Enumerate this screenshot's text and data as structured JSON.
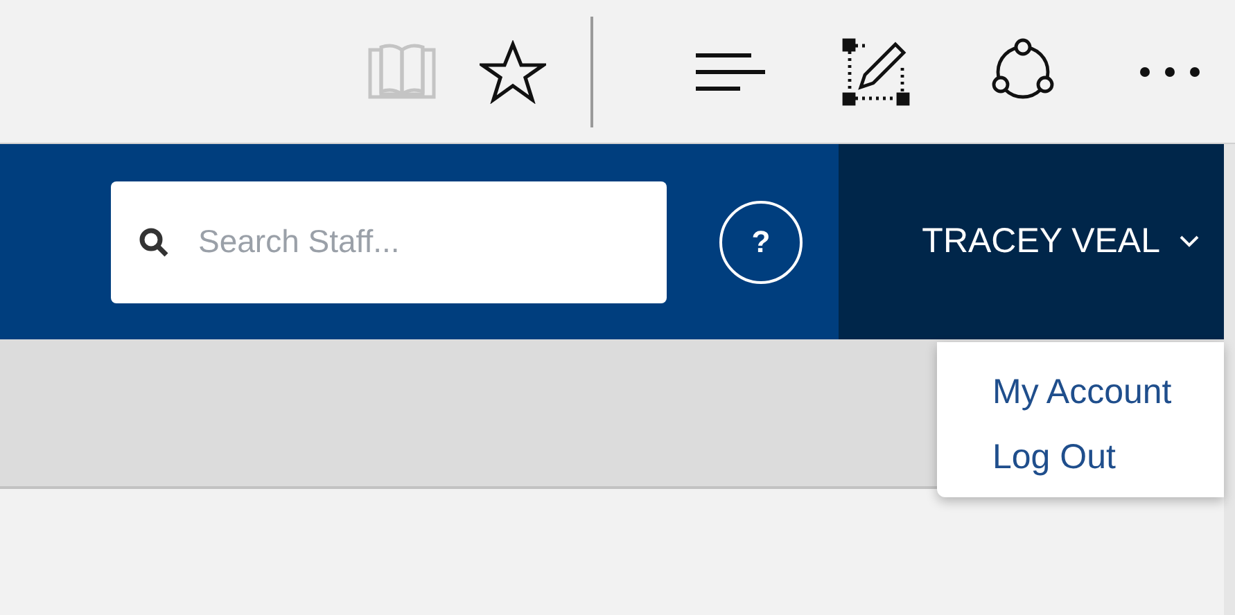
{
  "browser_toolbar": {
    "items": [
      {
        "kind": "reading",
        "disabled": true
      },
      {
        "kind": "favorite",
        "disabled": false
      },
      {
        "kind": "separator"
      },
      {
        "kind": "hub",
        "disabled": false
      },
      {
        "kind": "note",
        "disabled": false
      },
      {
        "kind": "share",
        "disabled": false
      },
      {
        "kind": "more",
        "disabled": false
      }
    ]
  },
  "header": {
    "search": {
      "placeholder": "Search Staff..."
    },
    "help": "?",
    "user": {
      "name": "TRACEY VEAL",
      "expanded": true
    }
  },
  "user_menu": [
    {
      "label": "My Account"
    },
    {
      "label": "Log Out"
    }
  ]
}
